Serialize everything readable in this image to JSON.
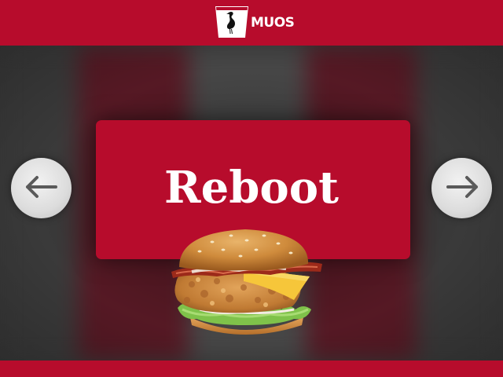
{
  "header": {
    "brand_text": "MUOS",
    "logo_icon": "heron-bucket-logo"
  },
  "card": {
    "title": "Reboot"
  },
  "navigation": {
    "prev_icon": "arrow-left-icon",
    "next_icon": "arrow-right-icon"
  },
  "image": {
    "icon": "burger-image"
  },
  "colors": {
    "brand_red": "#b70c2c",
    "background": "#3c3c3c",
    "button_gray": "#dcdcdc",
    "arrow_gray": "#5a5a5a"
  }
}
